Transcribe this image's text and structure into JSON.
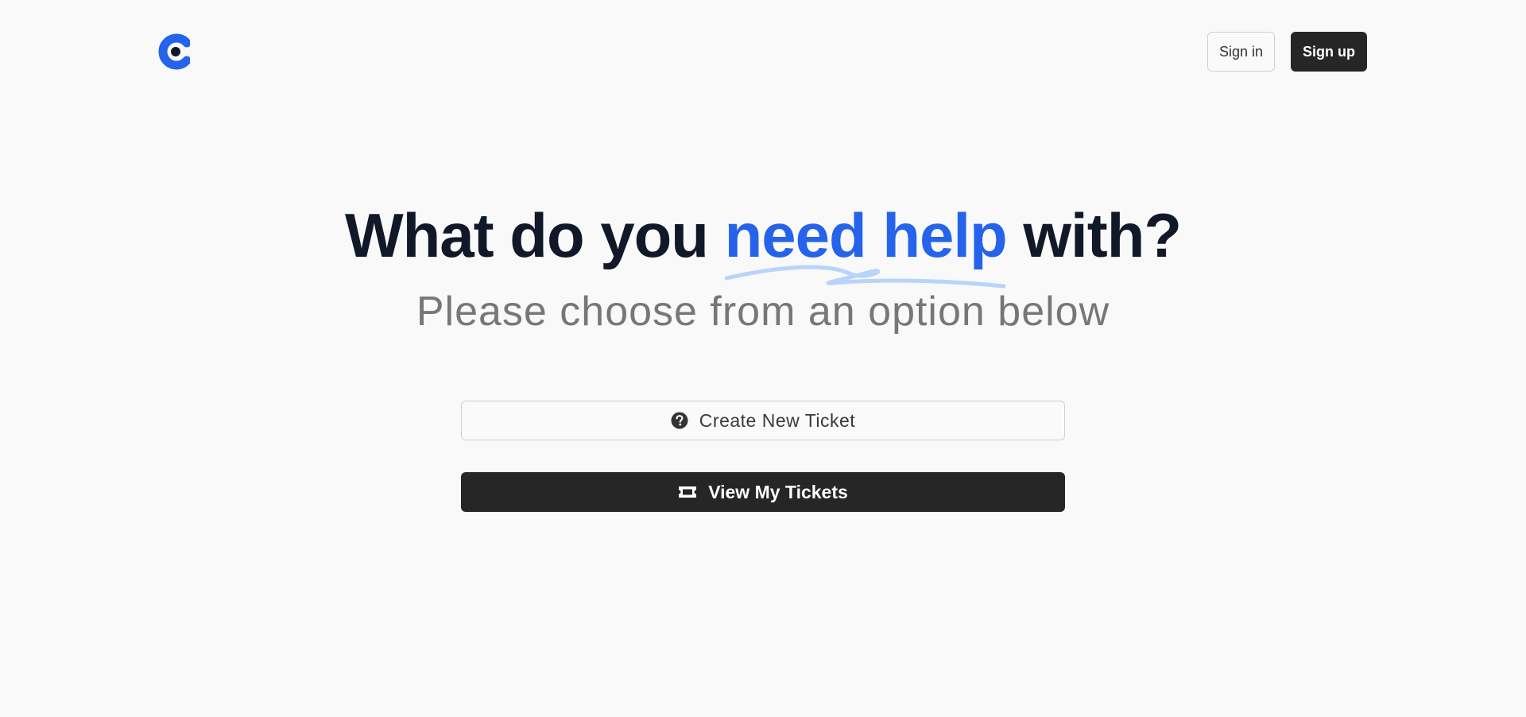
{
  "header": {
    "logo_icon": "brand-c-logo-icon",
    "signin_label": "Sign in",
    "signup_label": "Sign up"
  },
  "hero": {
    "headline_before": "What do you",
    "headline_accent": "need help",
    "headline_after": "with?",
    "subheadline": "Please choose from an option below"
  },
  "actions": {
    "create_label": "Create New Ticket",
    "create_icon": "question-circle-icon",
    "view_label": "View My Tickets",
    "view_icon": "ticket-icon"
  },
  "colors": {
    "accent": "#2563eb",
    "squiggle": "#b8d4fb",
    "dark_button": "#262626",
    "background": "#f9f9f9"
  }
}
